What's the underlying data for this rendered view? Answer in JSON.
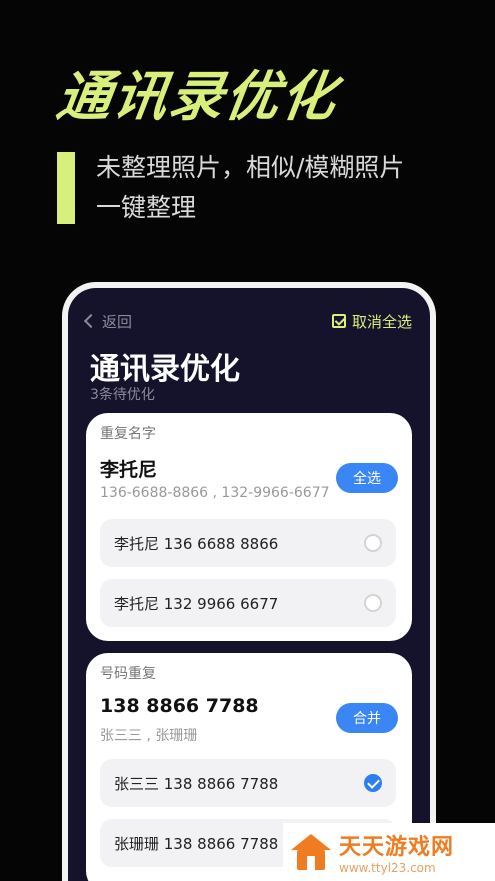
{
  "hero": {
    "title": "通讯录优化",
    "subtitle": "未整理照片，相似/模糊照片一键整理"
  },
  "app": {
    "back_label": "返回",
    "deselect_all_label": "取消全选",
    "title": "通讯录优化",
    "pending_count": "3条待优化",
    "colors": {
      "accent": "#d8ef7c",
      "primary_button": "#3b86f5",
      "background": "#15122c"
    }
  },
  "groups": [
    {
      "label": "重复名字",
      "name": "李托尼",
      "detail": "136-6688-8866 , 132-9966-6677",
      "action_label": "全选",
      "items": [
        {
          "text": "李托尼 136 6688 8866",
          "checked": false
        },
        {
          "text": "李托尼 132 9966 6677",
          "checked": false
        }
      ]
    },
    {
      "label": "号码重复",
      "name": "138 8866 7788",
      "detail": "张三三 , 张珊珊",
      "action_label": "合并",
      "items": [
        {
          "text": "张三三 138 8866 7788",
          "checked": true
        },
        {
          "text": "张珊珊 138 8866 7788",
          "checked": false
        }
      ]
    }
  ],
  "watermark": {
    "name": "天天游戏网",
    "url": "www.ttyl23.com"
  }
}
